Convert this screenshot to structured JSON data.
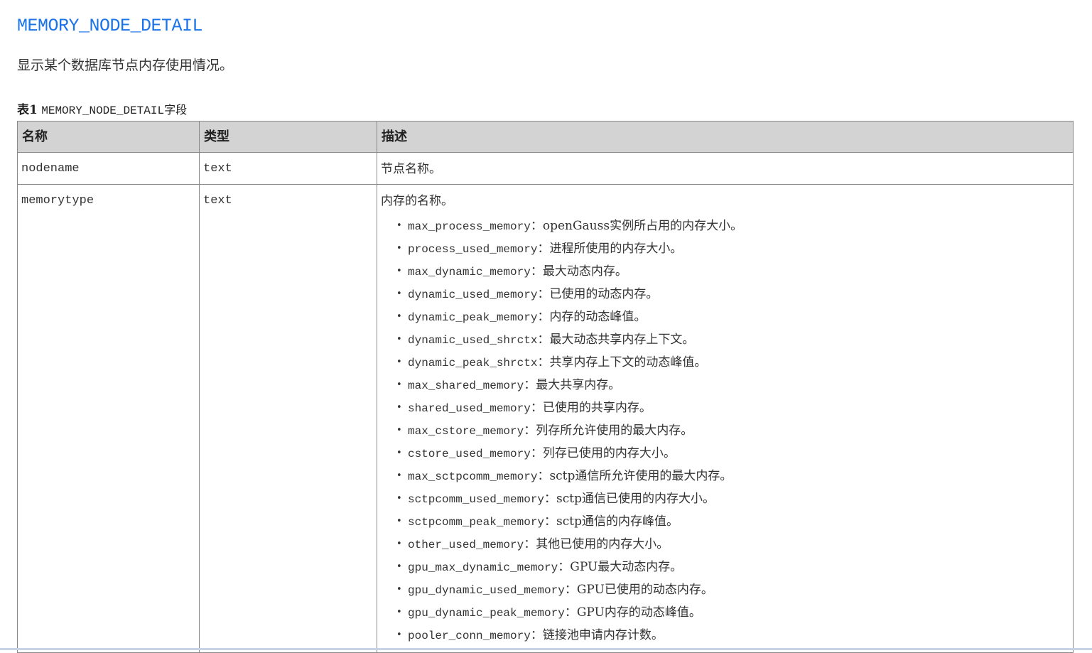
{
  "page": {
    "title": "MEMORY_NODE_DETAIL",
    "description": "显示某个数据库节点内存使用情况。"
  },
  "table": {
    "caption_label": "表1",
    "caption_text": "MEMORY_NODE_DETAIL字段",
    "headers": [
      "名称",
      "类型",
      "描述"
    ],
    "rows": [
      {
        "name": "nodename",
        "type": "text",
        "description": "节点名称。"
      },
      {
        "name": "memorytype",
        "type": "text",
        "description": "内存的名称。",
        "items": [
          {
            "name": "max_process_memory",
            "sep": "：",
            "text": "openGauss实例所占用的内存大小。"
          },
          {
            "name": "process_used_memory",
            "sep": "：",
            "text": "进程所使用的内存大小。"
          },
          {
            "name": "max_dynamic_memory",
            "sep": "：",
            "text": "最大动态内存。"
          },
          {
            "name": "dynamic_used_memory",
            "sep": "：",
            "text": "已使用的动态内存。"
          },
          {
            "name": "dynamic_peak_memory",
            "sep": "：",
            "text": "内存的动态峰值。"
          },
          {
            "name": "dynamic_used_shrctx",
            "sep": "：",
            "text": "最大动态共享内存上下文。"
          },
          {
            "name": "dynamic_peak_shrctx",
            "sep": "：",
            "text": "共享内存上下文的动态峰值。"
          },
          {
            "name": "max_shared_memory",
            "sep": "：",
            "text": "最大共享内存。"
          },
          {
            "name": "shared_used_memory",
            "sep": "：",
            "text": "已使用的共享内存。"
          },
          {
            "name": "max_cstore_memory",
            "sep": "：",
            "text": "列存所允许使用的最大内存。"
          },
          {
            "name": "cstore_used_memory",
            "sep": "：",
            "text": "列存已使用的内存大小。"
          },
          {
            "name": "max_sctpcomm_memory",
            "sep": "：",
            "text": "sctp通信所允许使用的最大内存。"
          },
          {
            "name": "sctpcomm_used_memory",
            "sep": "：",
            "text": "sctp通信已使用的内存大小。"
          },
          {
            "name": "sctpcomm_peak_memory",
            "sep": "：",
            "text": "sctp通信的内存峰值。"
          },
          {
            "name": "other_used_memory",
            "sep": "：",
            "text": "其他已使用的内存大小。"
          },
          {
            "name": "gpu_max_dynamic_memory",
            "sep": "：",
            "text": "GPU最大动态内存。"
          },
          {
            "name": "gpu_dynamic_used_memory",
            "sep": "：",
            "text": "GPU已使用的动态内存。"
          },
          {
            "name": "gpu_dynamic_peak_memory",
            "sep": "：",
            "text": "GPU内存的动态峰值。"
          },
          {
            "name": "pooler_conn_memory",
            "sep": "：",
            "text": "链接池申请内存计数。"
          }
        ]
      }
    ]
  },
  "colors": {
    "title": "#1a73e8",
    "header_bg": "#d3d3d3",
    "border": "#8a8a8a",
    "text": "#333333"
  }
}
